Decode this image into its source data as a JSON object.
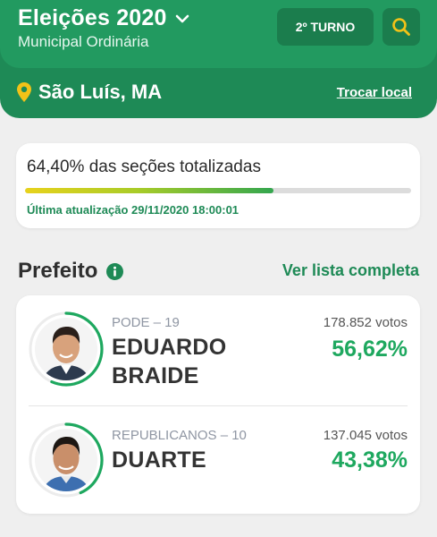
{
  "header": {
    "title": "Eleições 2020",
    "subtitle": "Municipal Ordinária",
    "turno_label": "2º TURNO",
    "location": "São Luís, MA",
    "change_location": "Trocar local"
  },
  "progress": {
    "title": "64,40% das seções totalizadas",
    "value": 0.644,
    "updated": "Última atualização 29/11/2020 18:00:01"
  },
  "section": {
    "title": "Prefeito",
    "link": "Ver lista completa"
  },
  "candidates": [
    {
      "party": "PODE – 19",
      "name_line1": "EDUARDO",
      "name_line2": "BRAIDE",
      "votes": "178.852 votos",
      "percent": "56,62%",
      "share": 0.5662
    },
    {
      "party": "REPUBLICANOS – 10",
      "name_line1": "DUARTE",
      "name_line2": "",
      "votes": "137.045 votos",
      "percent": "43,38%",
      "share": 0.4338
    }
  ],
  "colors": {
    "brand_green": "#229a60",
    "header_green": "#1e8a56",
    "percent_green": "#1ea85f",
    "accent_yellow": "#f2c218"
  },
  "icons": [
    "chevron-down-icon",
    "search-icon",
    "location-pin-icon",
    "info-icon"
  ]
}
